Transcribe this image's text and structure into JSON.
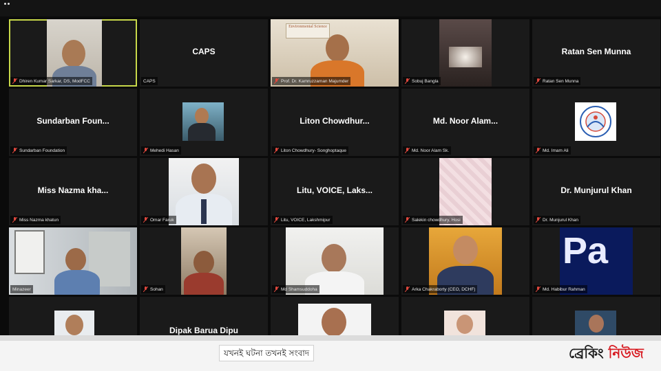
{
  "tiles": [
    {
      "name": "Dhiren Kumar Sarkar, DS, ModFCC"
    },
    {
      "title": "CAPS",
      "name": "CAPS"
    },
    {
      "name": "Prof. Dr. Kamruzzaman Majumder",
      "poster": "Environmental Science"
    },
    {
      "name": "Sobuj Bangla"
    },
    {
      "title": "Ratan Sen Munna",
      "name": "Ratan Sen Munna"
    },
    {
      "title": "Sundarban Foun...",
      "name": "Sundarban Foundation"
    },
    {
      "name": "Mehedi Hasan"
    },
    {
      "title": "Liton Chowdhur...",
      "name": "Liton Chowdhury- Songhoptaque"
    },
    {
      "title": "Md. Noor Alam...",
      "name": "Md. Noor Alam Sk."
    },
    {
      "name": "Md. Imam Ali"
    },
    {
      "title": "Miss Nazma kha...",
      "name": "Miss Nazma khatun"
    },
    {
      "name": "Omar Faruk"
    },
    {
      "title": "Litu, VOICE, Laks...",
      "name": "Litu, VOICE, Lakshmipur"
    },
    {
      "name": "Salekin chowdhury, Hosi"
    },
    {
      "title": "Dr. Munjurul Khan",
      "name": "Dr. Munjurul Khan"
    },
    {
      "name": "Minazeer"
    },
    {
      "name": "Sohan"
    },
    {
      "name": "Md Shamsuddoha"
    },
    {
      "name": "Arka Chakraborty (CEO, DCHF)"
    },
    {
      "name": "Md. Habibur Rahman",
      "screen_text": "Pa"
    },
    {
      "name": ""
    },
    {
      "title": "Dipak Barua Dipu",
      "name": ""
    },
    {
      "name": ""
    },
    {
      "name": ""
    },
    {
      "name": ""
    }
  ],
  "ticker": {
    "tagline": "যখনই ঘটনা তখনই সংবাদ",
    "brand_part1": "ব্রেকিং ",
    "brand_part2": "নিউজ"
  },
  "colors": {
    "active_border": "#c8d84a",
    "mute_icon": "#e0483e",
    "brand_red": "#d71920"
  }
}
